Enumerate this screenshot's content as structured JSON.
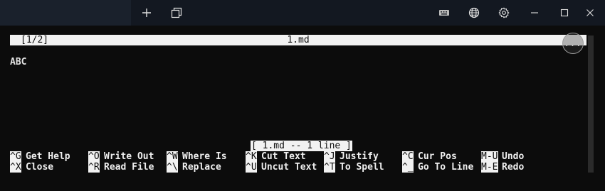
{
  "titlebar": {
    "new_tab_icon": "plus-icon",
    "restore_tab_icon": "duplicate-tab-icon",
    "keyboard_icon": "keyboard-icon",
    "globe_icon": "globe-icon",
    "settings_icon": "gear-icon",
    "minimize_icon": "minimize-icon",
    "maximize_icon": "maximize-icon",
    "close_icon": "close-icon"
  },
  "editor": {
    "buffer_indicator": "[1/2]",
    "file_name": "1.md",
    "more_label": "...",
    "content_lines": [
      "ABC"
    ],
    "status_message": "[ 1.md -- 1 line ]"
  },
  "shortcuts": {
    "row1": [
      {
        "key": "^G",
        "label": "Get Help"
      },
      {
        "key": "^O",
        "label": "Write Out"
      },
      {
        "key": "^W",
        "label": "Where Is"
      },
      {
        "key": "^K",
        "label": "Cut Text"
      },
      {
        "key": "^J",
        "label": "Justify"
      },
      {
        "key": "^C",
        "label": "Cur Pos"
      },
      {
        "key": "M-U",
        "label": "Undo"
      }
    ],
    "row2": [
      {
        "key": "^X",
        "label": "Close"
      },
      {
        "key": "^R",
        "label": "Read File"
      },
      {
        "key": "^\\",
        "label": "Replace"
      },
      {
        "key": "^U",
        "label": "Uncut Text"
      },
      {
        "key": "^T",
        "label": "To Spell"
      },
      {
        "key": "^_",
        "label": "Go To Line"
      },
      {
        "key": "M-E",
        "label": "Redo"
      }
    ]
  },
  "colors": {
    "terminal_bg": "#0c0c0c",
    "titlebar_bg": "#131821",
    "inverse_bg": "#f2f2f2",
    "text": "#e6e6e6"
  }
}
